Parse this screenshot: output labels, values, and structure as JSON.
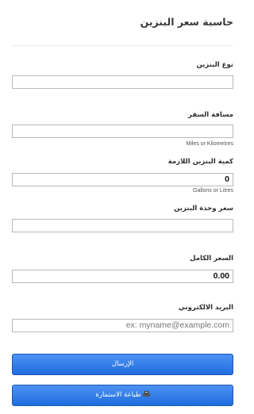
{
  "form": {
    "title": "حاسبة سعر البنزين",
    "fuel_type": {
      "label": "نوع البنزين",
      "value": ""
    },
    "distance": {
      "label": "مسافة السفر",
      "value": "",
      "hint": "Miles or Kilometres"
    },
    "fuel_needed": {
      "label": "كمية البنزين اللازمة",
      "value": "0",
      "hint": "Gallons or Litres"
    },
    "unit_price": {
      "label": "سعر وحدة البنزين",
      "value": ""
    },
    "total_price": {
      "label": "السعر الكامل",
      "value": "0.00"
    },
    "email": {
      "label": "البريد الالكتروني",
      "value": "",
      "placeholder": "ex: myname@example.com"
    },
    "submit_label": "الإرسال",
    "print_label": "طباعة الاستمارة"
  },
  "colors": {
    "button_top": "#4c92f2",
    "button_bottom": "#1f6ddf"
  },
  "icons": {
    "print": "printer-icon"
  }
}
